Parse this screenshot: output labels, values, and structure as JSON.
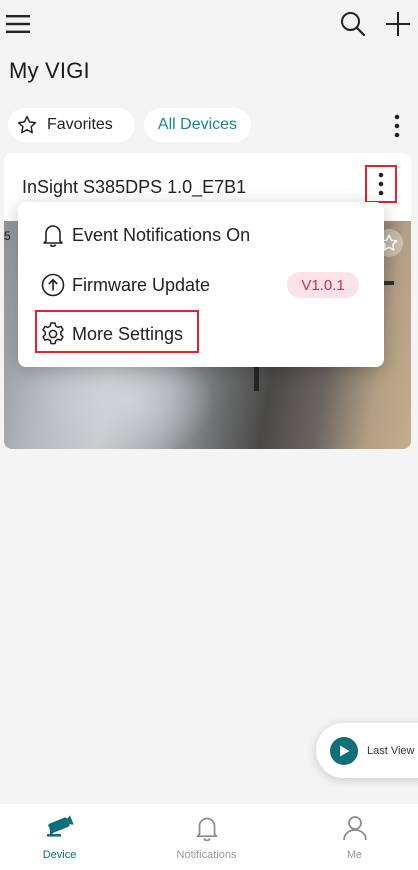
{
  "header": {
    "title": "My VIGI",
    "icons": [
      "hamburger-menu-icon",
      "search-icon",
      "plus-icon"
    ]
  },
  "filters": {
    "favorites_label": "Favorites",
    "all_devices_label": "All Devices",
    "active": "All Devices"
  },
  "device": {
    "name": "InSight S385DPS 1.0_E7B1",
    "preview_tag": "5"
  },
  "dropdown": {
    "items": [
      {
        "label": "Event Notifications On",
        "icon": "bell-icon"
      },
      {
        "label": "Firmware Update",
        "icon": "upload-icon",
        "badge": "V1.0.1"
      },
      {
        "label": "More Settings",
        "icon": "gear-icon"
      }
    ]
  },
  "last_view": {
    "label": "Last View"
  },
  "tabbar": {
    "tabs": [
      {
        "label": "Device",
        "icon": "camera-icon",
        "active": true
      },
      {
        "label": "Notifications",
        "icon": "bell-icon",
        "active": false
      },
      {
        "label": "Me",
        "icon": "person-icon",
        "active": false
      }
    ]
  },
  "colors": {
    "accent": "#138a8a",
    "tab_active": "#0f6f78",
    "highlight_red": "#d9262f",
    "badge_bg": "#fbe3e7",
    "badge_text": "#cc2f55"
  }
}
